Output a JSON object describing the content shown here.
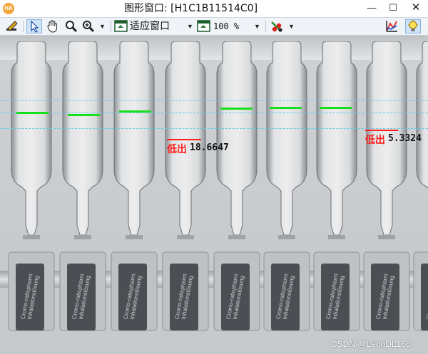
{
  "window": {
    "title": "图形窗口: [H1C1B11514C0]",
    "app_icon": "HA",
    "minimize_symbol": "—",
    "maximize_symbol": "☐",
    "close_symbol": "✕"
  },
  "toolbar": {
    "fit_label": "适应窗口",
    "zoom_label": "100 %",
    "icons": [
      "pencil-icon",
      "arrow-pointer-icon",
      "hand-pan-icon",
      "magnifier-icon",
      "zoom-magnifier-icon",
      "fit-window-icon",
      "zoom-percent-icon",
      "color-palette-icon",
      "profile-graph-icon",
      "lightbulb-icon"
    ]
  },
  "results": {
    "fail_label": "低出",
    "fail_1_value": "18.6647",
    "fail_2_value": "5.3324"
  },
  "ampoule_label_text": "Cromo-ratiopharm Inhalationslösung",
  "watermark": "CSDN @LeonDL168",
  "colors": {
    "level_ok": "#17e01a",
    "level_fail": "#ff1e1e",
    "reference_line": "#5ecbe6"
  }
}
